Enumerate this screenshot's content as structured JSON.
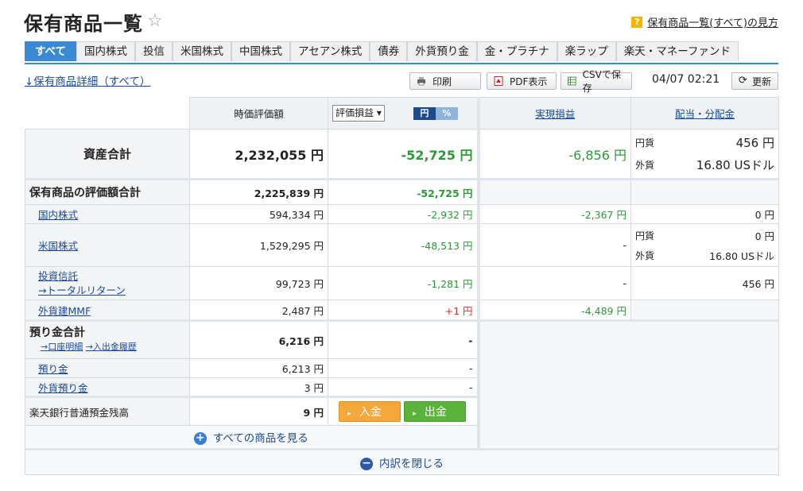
{
  "page": {
    "title": "保有商品一覧",
    "help_link": "保有商品一覧(すべて)の見方",
    "help_badge": "?"
  },
  "tabs": [
    "すべて",
    "国内株式",
    "投信",
    "米国株式",
    "中国株式",
    "アセアン株式",
    "債券",
    "外貨預り金",
    "金・プラチナ",
    "楽ラップ",
    "楽天・マネーファンド"
  ],
  "toolbar": {
    "detail_link": "↓保有商品詳細（すべて）",
    "print": "印刷",
    "pdf": "PDF表示",
    "csv": "CSVで保存",
    "timestamp": "04/07 02:21",
    "refresh": "更新"
  },
  "headers": {
    "market_value": "時価評価額",
    "select_value": "評価損益",
    "toggle_yen": "円",
    "toggle_pct": "%",
    "realized": "実現損益",
    "dividend": "配当・分配金"
  },
  "asset_total": {
    "label": "資産合計",
    "value": "2,232,055 円",
    "pl": "-52,725 円",
    "realized": "-6,856 円",
    "div_yen_label": "円貨",
    "div_yen": "456 円",
    "div_fx_label": "外貨",
    "div_fx": "16.80 USドル"
  },
  "holdings_total": {
    "label": "保有商品の評価額合計",
    "value": "2,225,839 円",
    "pl": "-52,725 円"
  },
  "rows": {
    "domestic": {
      "label": "国内株式",
      "value": "594,334 円",
      "pl": "-2,932 円",
      "realized": "-2,367 円",
      "div": "0 円"
    },
    "us": {
      "label": "米国株式",
      "value": "1,529,295 円",
      "pl": "-48,513 円",
      "realized": "-",
      "div_yen_label": "円貨",
      "div_yen": "0 円",
      "div_fx_label": "外貨",
      "div_fx": "16.80 USドル"
    },
    "fund": {
      "label": "投資信託",
      "sublabel": "→トータルリターン",
      "value": "99,723 円",
      "pl": "-1,281 円",
      "realized": "-",
      "div": "456 円"
    },
    "mmf": {
      "label": "外貨建MMF",
      "value": "2,487 円",
      "pl": "+1 円",
      "realized": "-4,489 円"
    }
  },
  "deposit_total": {
    "label": "預り金合計",
    "link1": "→口座明細",
    "link2": "→入出金履歴",
    "value": "6,216 円",
    "pl": "-"
  },
  "deposit_rows": {
    "yen": {
      "label": "預り金",
      "value": "6,213 円",
      "pl": "-"
    },
    "fx": {
      "label": "外貨預り金",
      "value": "3 円",
      "pl": "-"
    }
  },
  "bank": {
    "label": "楽天銀行普通預金残高",
    "value": "9 円",
    "deposit_btn": "入金",
    "withdraw_btn": "出金"
  },
  "footer": {
    "see_all": "すべての商品を見る",
    "close": "内訳を閉じる"
  }
}
